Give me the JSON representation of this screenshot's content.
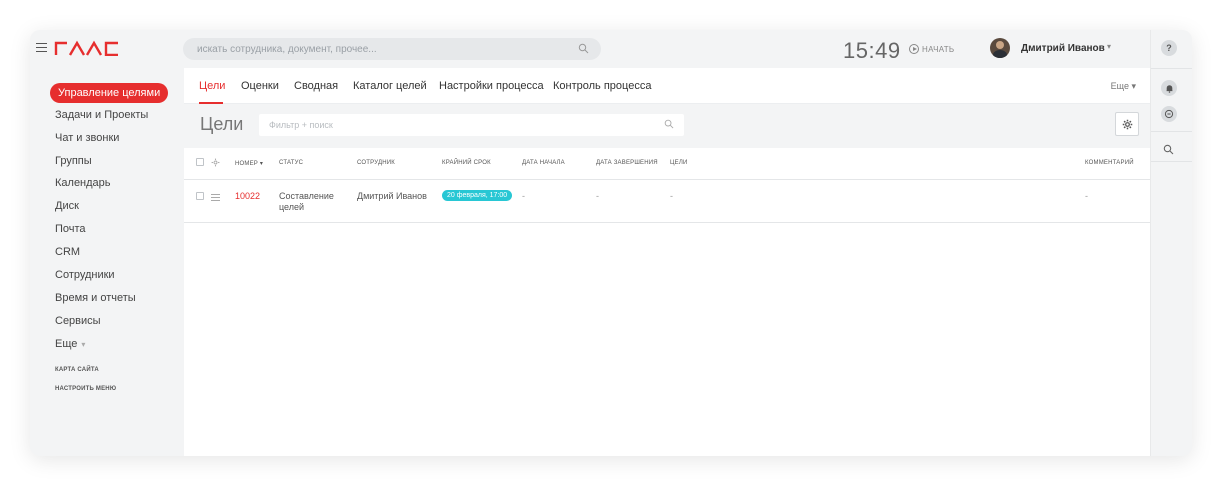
{
  "header": {
    "search_placeholder": "искать сотрудника, документ, прочее...",
    "clock": "15:49",
    "start_label": "НАЧАТЬ",
    "user_name": "Дмитрий Иванов",
    "user_caret": "▾"
  },
  "sidebar": {
    "active_item": "Управление целями",
    "items": [
      "Задачи и Проекты",
      "Чат и звонки",
      "Группы",
      "Календарь",
      "Диск",
      "Почта",
      "CRM",
      "Сотрудники",
      "Время и отчеты",
      "Сервисы"
    ],
    "more_label": "Еще",
    "small_links": [
      "КАРТА САЙТА",
      "НАСТРОИТЬ МЕНЮ"
    ]
  },
  "tabs": {
    "items": [
      "Цели",
      "Оценки",
      "Сводная",
      "Каталог целей",
      "Настройки процесса",
      "Контроль процесса"
    ],
    "more_label": "Еще ▾"
  },
  "toolbar": {
    "title": "Цели",
    "filter_placeholder": "Фильтр + поиск"
  },
  "table": {
    "columns": {
      "number": "НОМЕР",
      "status": "СТАТУС",
      "employee": "СОТРУДНИК",
      "deadline": "КРАЙНИЙ СРОК",
      "start_date": "ДАТА НАЧАЛА",
      "end_date": "ДАТА ЗАВЕРШЕНИЯ",
      "goals": "ЦЕЛИ",
      "comment": "КОММЕНТАРИЙ"
    },
    "rows": [
      {
        "number": "10022",
        "status": "Составление целей",
        "employee": "Дмитрий Иванов",
        "deadline": "20 февраля, 17:00",
        "start_date": "-",
        "end_date": "-",
        "goals": "-",
        "comment": "-"
      }
    ]
  },
  "rail": {
    "help": "?"
  },
  "colors": {
    "accent": "#e62e2e",
    "deadline_badge": "#28c7d4",
    "background": "#f3f4f5"
  }
}
